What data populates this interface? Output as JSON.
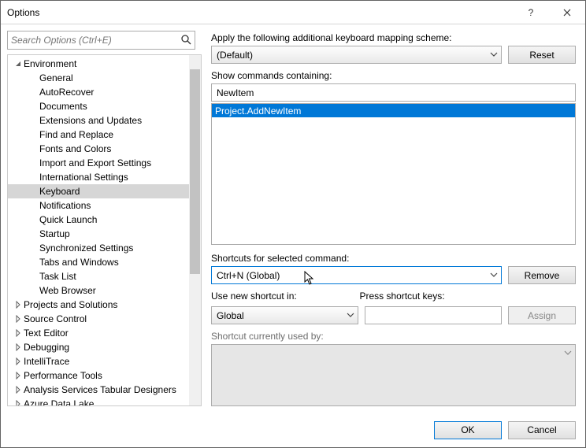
{
  "window": {
    "title": "Options"
  },
  "search": {
    "placeholder": "Search Options (Ctrl+E)"
  },
  "tree": {
    "environment_label": "Environment",
    "children": [
      "General",
      "AutoRecover",
      "Documents",
      "Extensions and Updates",
      "Find and Replace",
      "Fonts and Colors",
      "Import and Export Settings",
      "International Settings",
      "Keyboard",
      "Notifications",
      "Quick Launch",
      "Startup",
      "Synchronized Settings",
      "Tabs and Windows",
      "Task List",
      "Web Browser"
    ],
    "selected_child_index": 8,
    "siblings": [
      "Projects and Solutions",
      "Source Control",
      "Text Editor",
      "Debugging",
      "IntelliTrace",
      "Performance Tools",
      "Analysis Services Tabular Designers",
      "Azure Data Lake"
    ]
  },
  "right": {
    "scheme_label": "Apply the following additional keyboard mapping scheme:",
    "scheme_value": "(Default)",
    "reset_label": "Reset",
    "show_commands_label": "Show commands containing:",
    "show_commands_value": "NewItem",
    "command_list": [
      "Project.AddNewItem"
    ],
    "command_selected_index": 0,
    "shortcuts_label": "Shortcuts for selected command:",
    "shortcut_value": "Ctrl+N (Global)",
    "remove_label": "Remove",
    "use_in_label": "Use new shortcut in:",
    "use_in_value": "Global",
    "press_keys_label": "Press shortcut keys:",
    "press_keys_value": "",
    "assign_label": "Assign",
    "currently_used_label": "Shortcut currently used by:"
  },
  "footer": {
    "ok": "OK",
    "cancel": "Cancel"
  }
}
